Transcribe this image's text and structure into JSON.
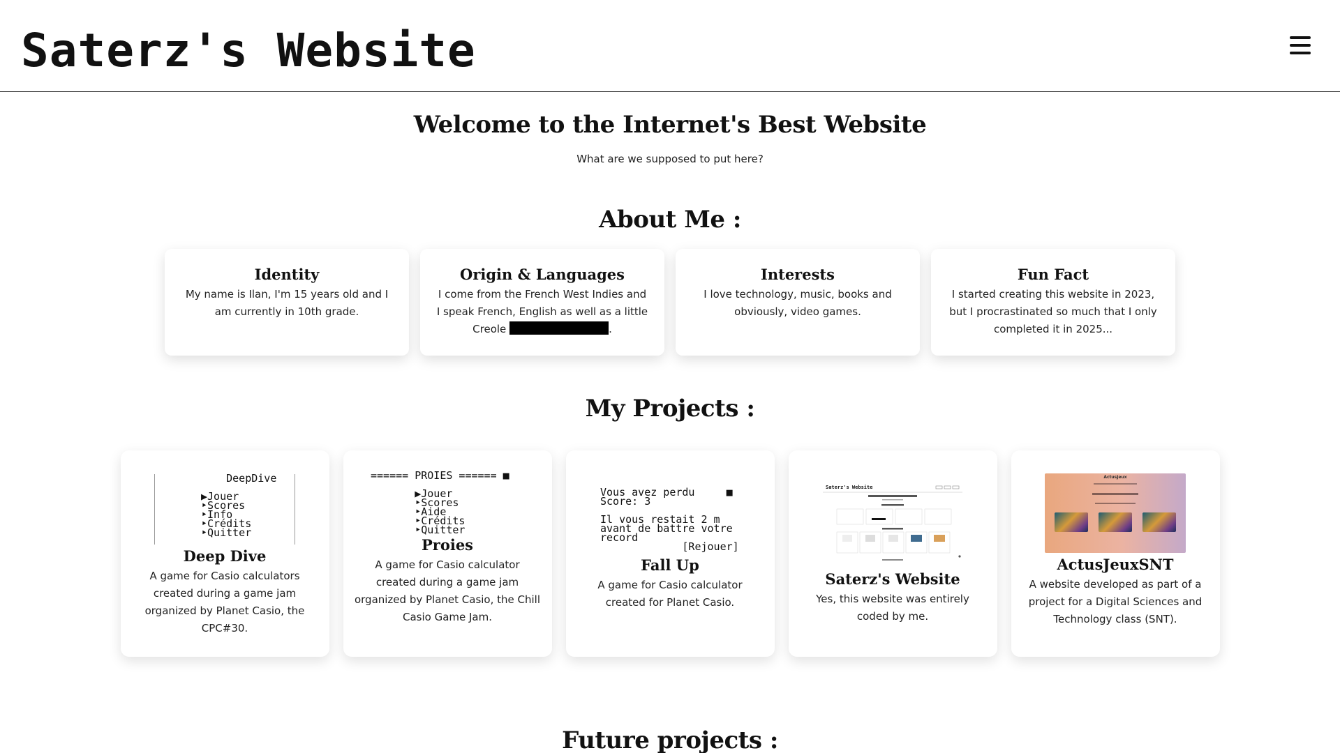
{
  "header": {
    "title": "Saterz's Website",
    "menu_icon": "hamburger-menu-icon"
  },
  "hero": {
    "title": "Welcome to the Internet's Best Website",
    "subtitle": "What are we supposed to put here?"
  },
  "about": {
    "heading": "About Me :",
    "cards": [
      {
        "title": "Identity",
        "text": "My name is Ilan, I'm 15 years old and I am currently in 10th grade."
      },
      {
        "title": "Origin & Languages",
        "text": "I come from the French West Indies and I speak French, English as well as a little Creole",
        "text_after": "."
      },
      {
        "title": "Interests",
        "text": "I love technology, music, books and obviously, video games."
      },
      {
        "title": "Fun Fact",
        "text": "I started creating this website in 2023, but I procrastinated so much that I only completed it in 2025..."
      }
    ]
  },
  "projects": {
    "heading": "My Projects :",
    "items": [
      {
        "title": "Deep Dive",
        "text": "A game for Casio calculators created during a game jam organized by Planet Casio, the CPC#30.",
        "screen": "    DeepDive\n\n▶Jouer\n‣Scores\n‣Info\n‣Crédits\n‣Quitter"
      },
      {
        "title": "Proies",
        "text": "A game for Casio calculator created during a game jam organized by Planet Casio, the Chill Casio Game Jam.",
        "screen": "====== PROIES ====== ■\n\n       ▶Jouer\n       ‣Scores\n       ‣Aide\n       ‣Crédits\n       ‣Quitter"
      },
      {
        "title": "Fall Up",
        "text": "A game for Casio calculator created for Planet Casio.",
        "screen": "Vous avez perdu     ■\nScore: 3\n\nIl vous restait 2 m\navant de battre votre\nrecord\n             [Rejouer]"
      },
      {
        "title": "Saterz's Website",
        "text": "Yes, this website was entirely coded by me.",
        "mini_title": "Saterz's Website"
      },
      {
        "title": "ActusJeuxSNT",
        "text": "A website developed as part of a project for a Digital Sciences and Technology class (SNT).",
        "mini_title": "ActusJeux"
      }
    ]
  },
  "future": {
    "heading": "Future projects :"
  }
}
